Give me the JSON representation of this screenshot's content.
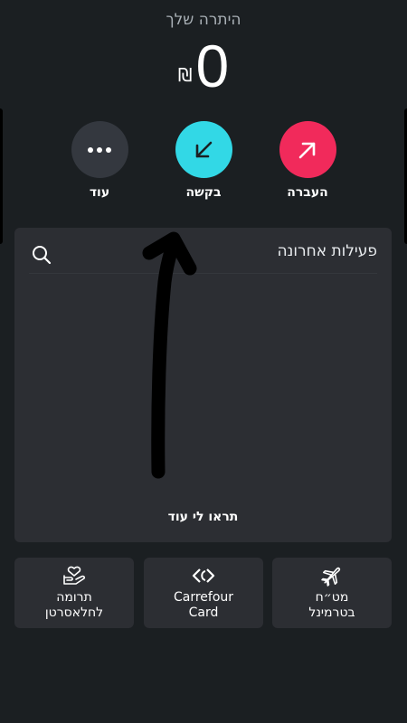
{
  "balance": {
    "label": "היתרה שלך",
    "amount": "0",
    "currency": "₪"
  },
  "actions": [
    {
      "label": "העברה",
      "icon": "arrow-up-right-icon",
      "color": "#f12a5b"
    },
    {
      "label": "בקשה",
      "icon": "arrow-down-left-icon",
      "color": "#32d8e6"
    },
    {
      "label": "עוד",
      "icon": "more-dots-icon",
      "color": "#34383f"
    }
  ],
  "activity": {
    "title": "פעילות אחרונה",
    "search_icon": "search-icon",
    "show_more": "תראו לי עוד"
  },
  "tiles": [
    {
      "label": "מט״ח\nבטרמינל",
      "icon": "airplane-icon"
    },
    {
      "label": "Carrefour\nCard",
      "icon": "carrefour-logo-icon"
    },
    {
      "label": "תרומה\nלחלאסרטן",
      "icon": "donation-hand-icon"
    }
  ],
  "colors": {
    "background": "#1b1f22",
    "card": "#2c2e33",
    "transfer": "#f12a5b",
    "request": "#32d8e6"
  }
}
